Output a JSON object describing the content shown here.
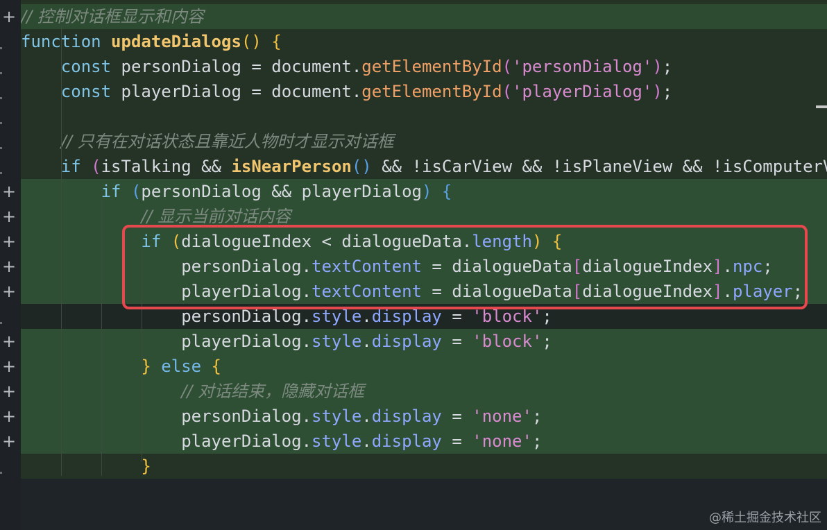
{
  "editor": {
    "lines": [
      {
        "segments": [
          [
            "cm",
            "// 控制对话框显示和内容"
          ]
        ]
      },
      {
        "segments": [
          [
            "kw",
            "function "
          ],
          [
            "fn",
            "updateDialogs"
          ],
          [
            "br1",
            "()"
          ],
          [
            "pun",
            " "
          ],
          [
            "br1",
            "{"
          ]
        ]
      },
      {
        "segments": [
          [
            "pun",
            "    "
          ],
          [
            "kw",
            "const "
          ],
          [
            "pun",
            "personDialog = document."
          ],
          [
            "mt",
            "getElementById"
          ],
          [
            "br2",
            "("
          ],
          [
            "str",
            "'personDialog'"
          ],
          [
            "br2",
            ")"
          ],
          [
            "pun",
            ";"
          ]
        ]
      },
      {
        "segments": [
          [
            "pun",
            "    "
          ],
          [
            "kw",
            "const "
          ],
          [
            "pun",
            "playerDialog = document."
          ],
          [
            "mt",
            "getElementById"
          ],
          [
            "br2",
            "("
          ],
          [
            "str",
            "'playerDialog'"
          ],
          [
            "br2",
            ")"
          ],
          [
            "pun",
            ";"
          ]
        ]
      },
      {
        "segments": [
          [
            "pun",
            ""
          ]
        ]
      },
      {
        "segments": [
          [
            "pun",
            "    "
          ],
          [
            "cm",
            "// 只有在对话状态且靠近人物时才显示对话框"
          ]
        ]
      },
      {
        "segments": [
          [
            "pun",
            "    "
          ],
          [
            "kw",
            "if "
          ],
          [
            "br2",
            "("
          ],
          [
            "pun",
            "isTalking && "
          ],
          [
            "fn",
            "isNearPerson"
          ],
          [
            "br3",
            "()"
          ],
          [
            "pun",
            " && !isCarView && !isPlaneView && !isComputerV"
          ]
        ]
      },
      {
        "segments": [
          [
            "pun",
            "        "
          ],
          [
            "kw",
            "if "
          ],
          [
            "br3",
            "("
          ],
          [
            "pun",
            "personDialog && playerDialog"
          ],
          [
            "br3",
            ")"
          ],
          [
            "pun",
            " "
          ],
          [
            "br3",
            "{"
          ]
        ]
      },
      {
        "segments": [
          [
            "pun",
            "            "
          ],
          [
            "cm",
            "// 显示当前对话内容"
          ]
        ]
      },
      {
        "segments": [
          [
            "pun",
            "            "
          ],
          [
            "kw",
            "if "
          ],
          [
            "br1",
            "("
          ],
          [
            "pun",
            "dialogueIndex < dialogueData."
          ],
          [
            "prop",
            "length"
          ],
          [
            "br1",
            ")"
          ],
          [
            "pun",
            " "
          ],
          [
            "br1",
            "{"
          ]
        ]
      },
      {
        "segments": [
          [
            "pun",
            "                personDialog."
          ],
          [
            "prop",
            "textContent"
          ],
          [
            "pun",
            " = dialogueData"
          ],
          [
            "br2",
            "["
          ],
          [
            "pun",
            "dialogueIndex"
          ],
          [
            "br2",
            "]"
          ],
          [
            "pun",
            "."
          ],
          [
            "prop",
            "npc"
          ],
          [
            "pun",
            ";"
          ]
        ]
      },
      {
        "segments": [
          [
            "pun",
            "                playerDialog."
          ],
          [
            "prop",
            "textContent"
          ],
          [
            "pun",
            " = dialogueData"
          ],
          [
            "br2",
            "["
          ],
          [
            "pun",
            "dialogueIndex"
          ],
          [
            "br2",
            "]"
          ],
          [
            "pun",
            "."
          ],
          [
            "prop",
            "player"
          ],
          [
            "pun",
            ";"
          ]
        ]
      },
      {
        "segments": [
          [
            "pun",
            "                personDialog."
          ],
          [
            "prop",
            "style"
          ],
          [
            "pun",
            "."
          ],
          [
            "prop",
            "display"
          ],
          [
            "pun",
            " = "
          ],
          [
            "str",
            "'block'"
          ],
          [
            "pun",
            ";"
          ]
        ]
      },
      {
        "segments": [
          [
            "pun",
            "                playerDialog."
          ],
          [
            "prop",
            "style"
          ],
          [
            "pun",
            "."
          ],
          [
            "prop",
            "display"
          ],
          [
            "pun",
            " = "
          ],
          [
            "str",
            "'block'"
          ],
          [
            "pun",
            ";"
          ]
        ]
      },
      {
        "segments": [
          [
            "pun",
            "            "
          ],
          [
            "br1",
            "}"
          ],
          [
            "kw2",
            " else "
          ],
          [
            "br1",
            "{"
          ]
        ]
      },
      {
        "segments": [
          [
            "pun",
            "                "
          ],
          [
            "cm",
            "// 对话结束，隐藏对话框"
          ]
        ]
      },
      {
        "segments": [
          [
            "pun",
            "                personDialog."
          ],
          [
            "prop",
            "style"
          ],
          [
            "pun",
            "."
          ],
          [
            "prop",
            "display"
          ],
          [
            "pun",
            " = "
          ],
          [
            "str",
            "'none'"
          ],
          [
            "pun",
            ";"
          ]
        ]
      },
      {
        "segments": [
          [
            "pun",
            "                playerDialog."
          ],
          [
            "prop",
            "style"
          ],
          [
            "pun",
            "."
          ],
          [
            "prop",
            "display"
          ],
          [
            "pun",
            " = "
          ],
          [
            "str",
            "'none'"
          ],
          [
            "pun",
            ";"
          ]
        ]
      },
      {
        "segments": [
          [
            "pun",
            "            "
          ],
          [
            "br1",
            "}"
          ]
        ]
      }
    ],
    "gutter_markers": [
      "+",
      "",
      "",
      "",
      "",
      "",
      "",
      "+",
      "+",
      "+",
      "+",
      "+",
      "",
      "+",
      "+",
      "+",
      "+",
      "+",
      ""
    ]
  },
  "watermark": "@稀土掘金技术社区",
  "colors": {
    "highlight_border": "#e5484d",
    "added_line_bg": "#2f4f34"
  }
}
